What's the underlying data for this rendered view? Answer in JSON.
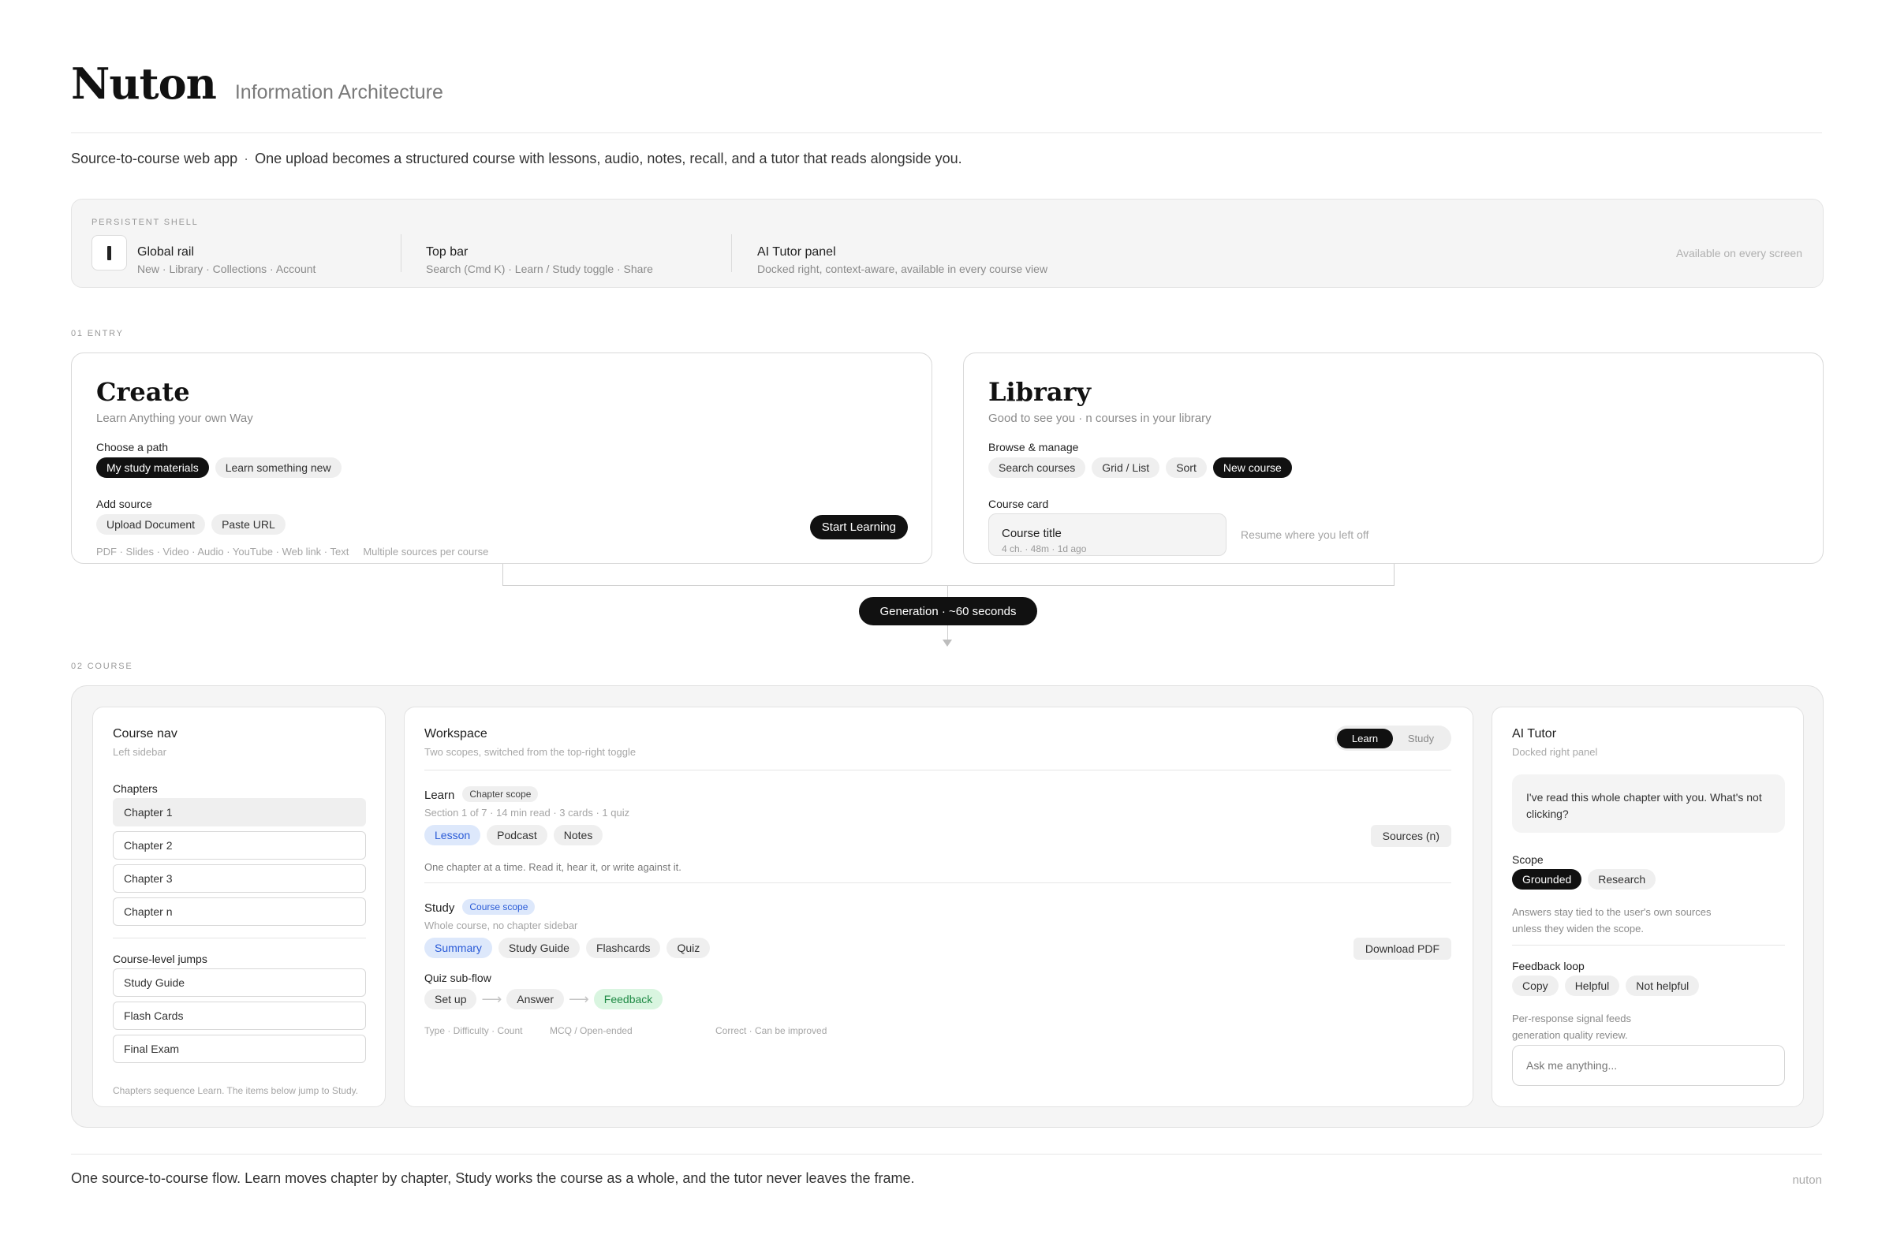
{
  "header": {
    "brand": "Nuton",
    "subtitle": "Information Architecture",
    "tagline_part1": "Source-to-course web app",
    "tagline_sep": "·",
    "tagline_part2": "One upload becomes a structured course with lessons, audio, notes, recall, and a tutor that reads alongside you."
  },
  "shell": {
    "eyebrow": "PERSISTENT SHELL",
    "items": [
      {
        "title": "Global rail",
        "detail": "New  ·  Library  ·  Collections  ·  Account"
      },
      {
        "title": "Top bar",
        "detail": "Search (Cmd K)  ·  Learn / Study toggle  ·  Share"
      },
      {
        "title": "AI Tutor panel",
        "detail": "Docked right, context-aware, available in every course view"
      }
    ],
    "note": "Available on every screen"
  },
  "entry": {
    "label": "01  ENTRY",
    "create": {
      "title": "Create",
      "subtitle": "Learn Anything your own Way",
      "path_label": "Choose a path",
      "paths": [
        "My study materials",
        "Learn something new"
      ],
      "source_label": "Add source",
      "sources": [
        "Upload Document",
        "Paste URL"
      ],
      "formats": "PDF · Slides · Video · Audio · YouTube · Web link · Text",
      "formats_note": "Multiple sources per course",
      "cta": "Start Learning"
    },
    "library": {
      "title": "Library",
      "subtitle": "Good to see you  ·  n courses in your library",
      "manage_label": "Browse & manage",
      "actions": [
        "Search courses",
        "Grid / List",
        "Sort",
        "New course"
      ],
      "card_label": "Course card",
      "card_title": "Course title",
      "card_meta": "4 ch.  ·  48m  ·  1d ago",
      "card_note": "Resume where you left off"
    }
  },
  "generation": {
    "text": "Generation  ·  ~60 seconds"
  },
  "course": {
    "label": "02  COURSE",
    "nav": {
      "title": "Course nav",
      "subtitle": "Left sidebar",
      "chapters_label": "Chapters",
      "chapters": [
        "Chapter 1",
        "Chapter 2",
        "Chapter 3",
        "Chapter n"
      ],
      "jumps_label": "Course-level jumps",
      "jumps": [
        "Study Guide",
        "Flash Cards",
        "Final Exam"
      ],
      "footnote": "Chapters sequence Learn. The items below jump to Study."
    },
    "workspace": {
      "title": "Workspace",
      "subtitle": "Two scopes, switched from the top-right toggle",
      "toggle": [
        "Learn",
        "Study"
      ],
      "learn": {
        "title": "Learn",
        "scope": "Chapter scope",
        "meta": "Section 1 of 7  ·  14 min read  ·  3 cards  ·  1 quiz",
        "tabs": [
          "Lesson",
          "Podcast",
          "Notes"
        ],
        "sources": "Sources (n)",
        "desc": "One chapter at a time. Read it, hear it, or write against it."
      },
      "study": {
        "title": "Study",
        "scope": "Course scope",
        "meta": "Whole course, no chapter sidebar",
        "tabs": [
          "Summary",
          "Study Guide",
          "Flashcards",
          "Quiz"
        ],
        "download": "Download PDF"
      },
      "quiz": {
        "title": "Quiz sub-flow",
        "steps": [
          "Set up",
          "Answer",
          "Feedback"
        ],
        "notes": [
          "Type · Difficulty · Count",
          "MCQ / Open-ended",
          "Correct · Can be improved"
        ]
      }
    },
    "tutor": {
      "title": "AI Tutor",
      "subtitle": "Docked right panel",
      "bubble": "I've read this whole chapter with you. What's not clicking?",
      "scope_label": "Scope",
      "scopes": [
        "Grounded",
        "Research"
      ],
      "scope_note": "Answers stay tied to the user's own sources unless they widen the scope.",
      "feedback_label": "Feedback loop",
      "feedback": [
        "Copy",
        "Helpful",
        "Not helpful"
      ],
      "feedback_note": "Per-response signal feeds generation quality review.",
      "input_placeholder": "Ask me anything..."
    }
  },
  "footer": {
    "text": "One source-to-course flow.  Learn moves chapter by chapter, Study works the course as a whole, and the tutor never leaves the frame.",
    "brand": "nuton"
  }
}
